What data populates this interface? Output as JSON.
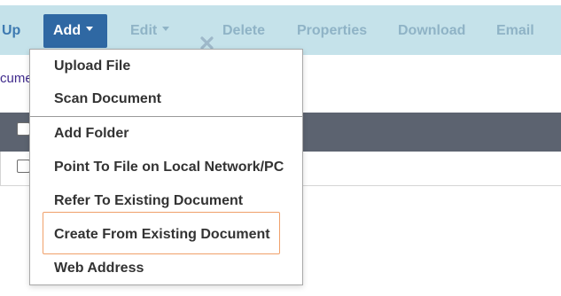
{
  "toolbar": {
    "up_label": "Up",
    "add_label": "Add",
    "edit_label": "Edit",
    "delete_label": "Delete",
    "properties_label": "Properties",
    "download_label": "Download",
    "email_label": "Email"
  },
  "breadcrumb": {
    "partial_text": "cume"
  },
  "add_menu": {
    "items": [
      {
        "label": "Upload File"
      },
      {
        "label": "Scan Document"
      },
      {
        "label": "Add Folder"
      },
      {
        "label": "Point To File on Local Network/PC"
      },
      {
        "label": "Refer To Existing Document"
      },
      {
        "label": "Create From Existing Document"
      },
      {
        "label": "Web Address"
      }
    ],
    "highlighted_item": "Create From Existing Document"
  },
  "colors": {
    "toolbar_bg": "#c5e2ea",
    "add_button_bg": "#2f68a3",
    "table_header_bg": "#5c6370",
    "disabled_text": "#8fb3c6",
    "highlight_border": "#f0a06a"
  }
}
